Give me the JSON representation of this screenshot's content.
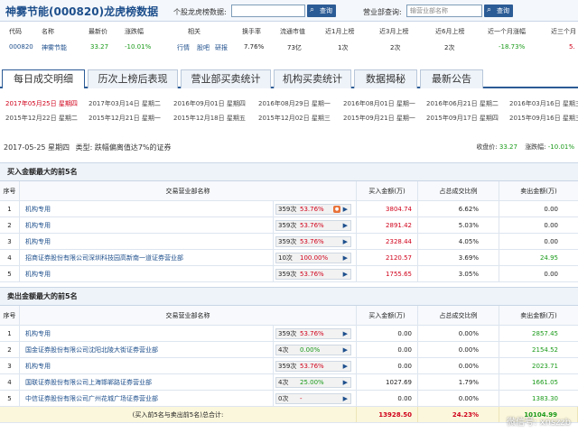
{
  "header": {
    "title": "神雾节能(000820)龙虎榜数据",
    "search_label": "个股龙虎榜数据:",
    "search_button": "查询",
    "broker_label": "营业部查询:",
    "broker_placeholder": "输营业部名称",
    "broker_button": "查询"
  },
  "summary": {
    "headers": [
      "代码",
      "名称",
      "最新价",
      "涨跌幅",
      "相关",
      "换手率",
      "流通市值",
      "近1月上榜",
      "近3月上榜",
      "近6月上榜",
      "近一个月涨幅",
      "近三个月"
    ],
    "row": {
      "code": "000820",
      "name": "神雾节能",
      "price": "33.27",
      "change": "-10.01%",
      "related": [
        "行情",
        "股吧",
        "研报"
      ],
      "turnover": "7.76%",
      "market_cap": "73亿",
      "m1": "1次",
      "m3": "2次",
      "m6": "2次",
      "month_change": "-18.73%",
      "m3_change": "5."
    }
  },
  "tabs": [
    "每日成交明细",
    "历次上榜后表现",
    "营业部买卖统计",
    "机构买卖统计",
    "数据揭秘",
    "最新公告"
  ],
  "dates": [
    "2017年05月25日 星期四",
    "2017年03月14日 星期二",
    "2016年09月01日 星期四",
    "2016年08月29日 星期一",
    "2016年08月01日 星期一",
    "2016年06月21日 星期二",
    "2016年03月16日 星期三",
    "2015年12月22日 星期二",
    "2015年12月21日 星期一",
    "2015年12月18日 星期五",
    "2015年12月02日 星期三",
    "2015年09月21日 星期一",
    "2015年09月17日 星期四",
    "2015年09月16日 星期三"
  ],
  "info": {
    "date": "2017-05-25 星期四",
    "type_label": "类型:",
    "type": "跌幅偏离值达7%的证券",
    "close_label": "收盘价:",
    "close": "33.27",
    "change_label": "涨跌幅:",
    "change": "-10.01%"
  },
  "columns": [
    "序号",
    "交易营业部名称",
    "买入金额(万)",
    "占总成交比例",
    "卖出金额(万)"
  ],
  "buy": {
    "title": "买入金额最大的前5名",
    "rows": [
      {
        "seq": "1",
        "name": "机构专用",
        "count": "359次",
        "pct": "53.76%",
        "amount": "3804.74",
        "ratio": "6.62%",
        "sell": "0.00"
      },
      {
        "seq": "2",
        "name": "机构专用",
        "count": "359次",
        "pct": "53.76%",
        "amount": "2891.42",
        "ratio": "5.03%",
        "sell": "0.00"
      },
      {
        "seq": "3",
        "name": "机构专用",
        "count": "359次",
        "pct": "53.76%",
        "amount": "2328.44",
        "ratio": "4.05%",
        "sell": "0.00"
      },
      {
        "seq": "4",
        "name": "招商证券股份有限公司深圳科技园高新南一道证券营业部",
        "count": "10次",
        "pct": "100.00%",
        "amount": "2120.57",
        "ratio": "3.69%",
        "sell": "24.95"
      },
      {
        "seq": "5",
        "name": "机构专用",
        "count": "359次",
        "pct": "53.76%",
        "amount": "1755.65",
        "ratio": "3.05%",
        "sell": "0.00"
      }
    ]
  },
  "sell": {
    "title": "卖出金额最大的前5名",
    "rows": [
      {
        "seq": "1",
        "name": "机构专用",
        "count": "359次",
        "pct": "53.76%",
        "amount": "0.00",
        "ratio": "0.00%",
        "sell": "2857.45"
      },
      {
        "seq": "2",
        "name": "国金证券股份有限公司沈阳北陵大街证券营业部",
        "count": "4次",
        "pct": "0.00%",
        "amount": "0.00",
        "ratio": "0.00%",
        "sell": "2154.52"
      },
      {
        "seq": "3",
        "name": "机构专用",
        "count": "359次",
        "pct": "53.76%",
        "amount": "0.00",
        "ratio": "0.00%",
        "sell": "2023.71"
      },
      {
        "seq": "4",
        "name": "国联证券股份有限公司上海邯郸路证券营业部",
        "count": "4次",
        "pct": "25.00%",
        "amount": "1027.69",
        "ratio": "1.79%",
        "sell": "1661.05"
      },
      {
        "seq": "5",
        "name": "中信证券股份有限公司广州花城广场证券营业部",
        "count": "0次",
        "pct": "-",
        "amount": "0.00",
        "ratio": "0.00%",
        "sell": "1383.30"
      }
    ]
  },
  "total": {
    "label": "(买入前5名与卖出前5名)总合计:",
    "amount": "13928.50",
    "ratio": "24.23%",
    "sell": "10104.99"
  },
  "watermark": "微信号: xnszzb"
}
